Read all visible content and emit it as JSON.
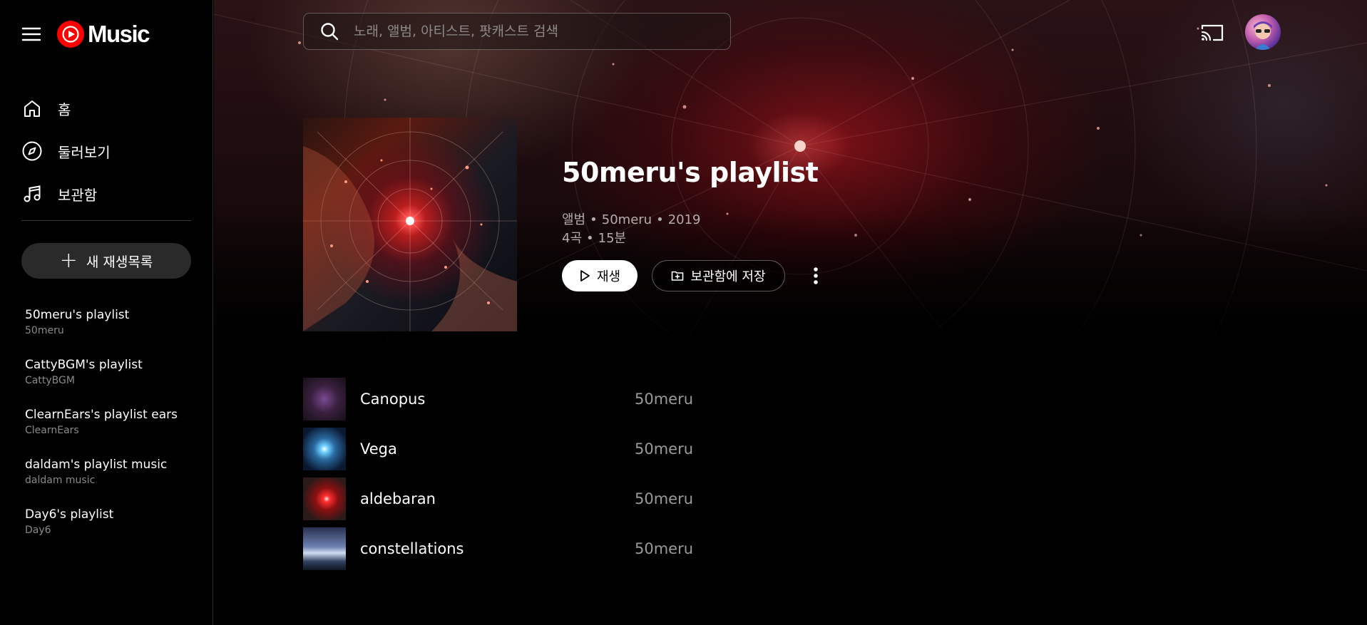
{
  "app": {
    "logo_text": "Music",
    "brand_color": "#ff0000"
  },
  "sidebar": {
    "nav": [
      {
        "label": "홈",
        "icon": "home-icon"
      },
      {
        "label": "둘러보기",
        "icon": "compass-icon"
      },
      {
        "label": "보관함",
        "icon": "music-note-icon"
      }
    ],
    "new_playlist_label": "새 재생목록",
    "playlists": [
      {
        "title": "50meru's playlist",
        "owner": "50meru"
      },
      {
        "title": "CattyBGM's playlist",
        "owner": "CattyBGM"
      },
      {
        "title": "ClearnEars's playlist ears",
        "owner": "ClearnEars"
      },
      {
        "title": "daldam's playlist music",
        "owner": "daldam music"
      },
      {
        "title": "Day6's playlist",
        "owner": "Day6"
      }
    ]
  },
  "search": {
    "placeholder": "노래, 앨범, 아티스트, 팟캐스트 검색",
    "value": ""
  },
  "header": {
    "title": "50meru's playlist",
    "type": "앨범",
    "artist": "50meru",
    "year": "2019",
    "track_count": "4곡",
    "duration": "15분",
    "separator": "•",
    "play_label": "재생",
    "save_label": "보관함에 저장"
  },
  "tracks": [
    {
      "title": "Canopus",
      "artist": "50meru"
    },
    {
      "title": "Vega",
      "artist": "50meru"
    },
    {
      "title": "aldebaran",
      "artist": "50meru"
    },
    {
      "title": "constellations",
      "artist": "50meru"
    }
  ]
}
